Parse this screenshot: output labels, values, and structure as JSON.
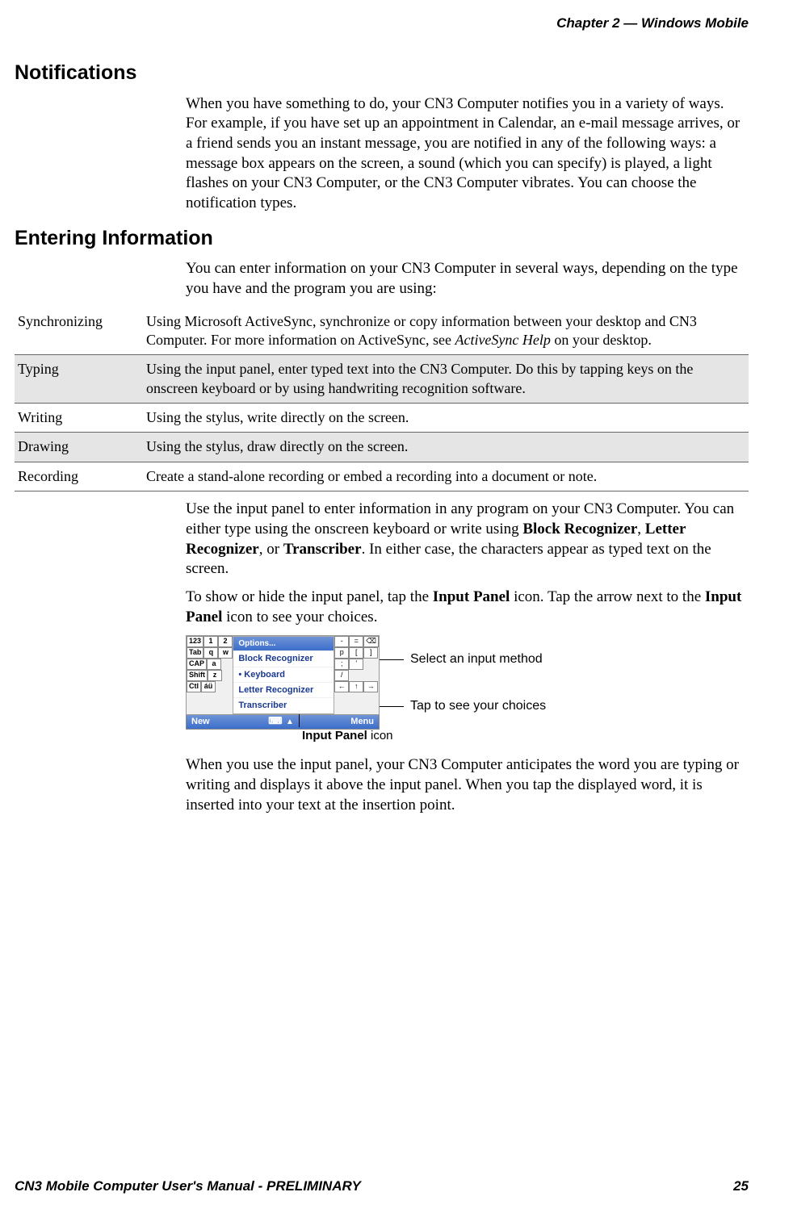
{
  "header": {
    "chapter": "Chapter 2 —  Windows Mobile"
  },
  "sections": {
    "notifications": {
      "title": "Notifications",
      "p1": "When you have something to do, your CN3 Computer notifies you in a variety of ways. For example, if you have set up an appointment in Calendar, an e-mail message arrives, or a friend sends you an instant message, you are notified in any of the following ways: a message box appears on the screen, a sound (which you can specify) is played, a light flashes on your CN3 Computer, or the CN3 Computer vibrates. You can choose the notification types."
    },
    "entering": {
      "title": "Entering Information",
      "p1": "You can enter information on your CN3 Computer in several ways, depending on the type you have and the program you are using:",
      "table": [
        {
          "label": "Synchronizing",
          "text_prefix": "Using Microsoft ActiveSync, synchronize or copy information between your desktop and CN3 Computer. For more information on ActiveSync, see ",
          "text_italic": "ActiveSync Help",
          "text_suffix": " on your desktop."
        },
        {
          "label": "Typing",
          "text": "Using the input panel, enter typed text into the CN3 Computer. Do this by tapping keys on the onscreen keyboard or by using handwriting recognition software."
        },
        {
          "label": "Writing",
          "text": "Using the stylus, write directly on the screen."
        },
        {
          "label": "Drawing",
          "text": "Using the stylus, draw directly on the screen."
        },
        {
          "label": "Recording",
          "text": "Create a stand-alone recording or embed a recording into a document or note."
        }
      ],
      "p2_prefix": "Use the input panel to enter information in any program on your CN3 Computer. You can either type using the onscreen keyboard or write using ",
      "p2_b1": "Block Recognizer",
      "p2_sep1": ", ",
      "p2_b2": "Letter Recognizer",
      "p2_sep2": ", or ",
      "p2_b3": "Transcriber",
      "p2_suffix": ". In either case, the characters appear as typed text on the screen.",
      "p3_prefix": "To show or hide the input panel, tap the ",
      "p3_b1": "Input Panel",
      "p3_mid": " icon. Tap the arrow next to the ",
      "p3_b2": "Input Panel",
      "p3_suffix": " icon to see your choices.",
      "p4": "When you use the input panel, your CN3 Computer anticipates the word you are typing or writing and displays it above the input panel. When you tap the displayed word, it is inserted into your text at the insertion point."
    }
  },
  "figure": {
    "popup_header": "Options...",
    "popup_items": [
      "Block Recognizer",
      "Keyboard",
      "Letter Recognizer",
      "Transcriber"
    ],
    "popup_selected_index": 1,
    "kbd_left_rows": [
      [
        "123",
        "1",
        "2"
      ],
      [
        "Tab",
        "q",
        "w"
      ],
      [
        "CAP",
        "a"
      ],
      [
        "Shift",
        "z"
      ],
      [
        "Ctl",
        "áü"
      ]
    ],
    "kbd_right_rows": [
      [
        "-",
        "=",
        "⌫"
      ],
      [
        "p",
        "[",
        "]"
      ],
      [
        ";",
        "'"
      ],
      [
        "/"
      ],
      [
        "←",
        "↑",
        "→"
      ]
    ],
    "bar_new": "New",
    "bar_menu": "Menu",
    "callout1": "Select an input method",
    "callout2": "Tap to see your choices",
    "caption_bold": "Input Panel",
    "caption_rest": " icon"
  },
  "footer": {
    "title": "CN3 Mobile Computer User's Manual - PRELIMINARY",
    "page": "25"
  }
}
